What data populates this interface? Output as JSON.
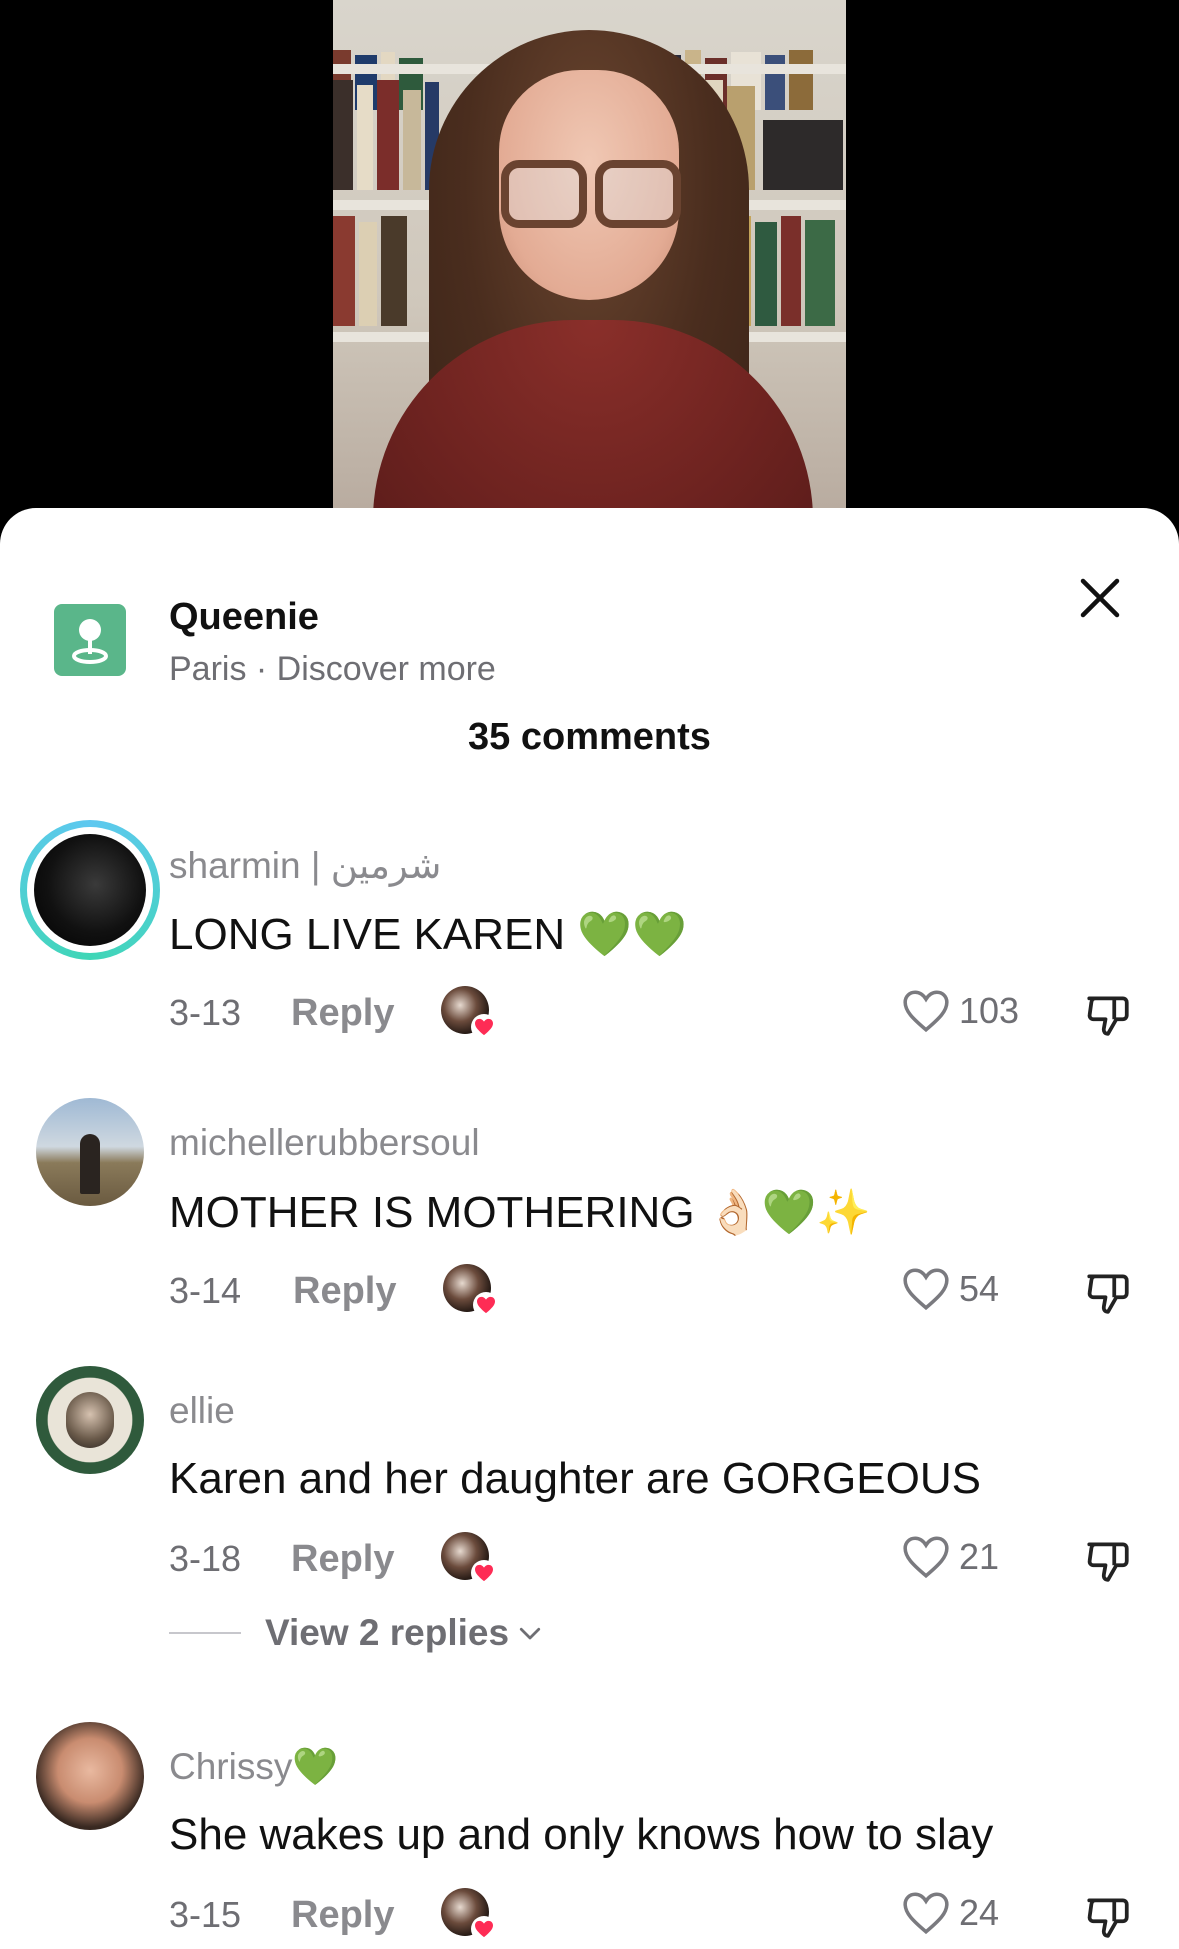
{
  "place": {
    "title": "Queenie",
    "subtitle": "Paris · Discover more"
  },
  "comments_header": "35 comments",
  "comments": [
    {
      "username": "sharmin | شرمین",
      "text": "LONG LIVE KAREN 💚💚",
      "date": "3-13",
      "reply": "Reply",
      "likes": "103"
    },
    {
      "username": "michellerubbersoul",
      "text": "MOTHER IS MOTHERING 👌🏻💚✨",
      "date": "3-14",
      "reply": "Reply",
      "likes": "54"
    },
    {
      "username": "ellie",
      "text": "Karen and her daughter are GORGEOUS",
      "date": "3-18",
      "reply": "Reply",
      "likes": "21"
    },
    {
      "username": "Chrissy💚",
      "text": "She wakes up and only knows how to slay",
      "date": "3-15",
      "reply": "Reply",
      "likes": "24"
    }
  ],
  "view_replies": "View 2 replies",
  "colors": {
    "place_icon": "#5ab68a",
    "story_ring_start": "#5ec8f0",
    "story_ring_end": "#3fd6b6",
    "heart_badge": "#fe2c55"
  },
  "icons": {
    "place": "location-pin-icon",
    "close": "close-icon",
    "like": "heart-outline-icon",
    "dislike": "thumbs-down-icon",
    "chevron": "chevron-down-icon"
  }
}
